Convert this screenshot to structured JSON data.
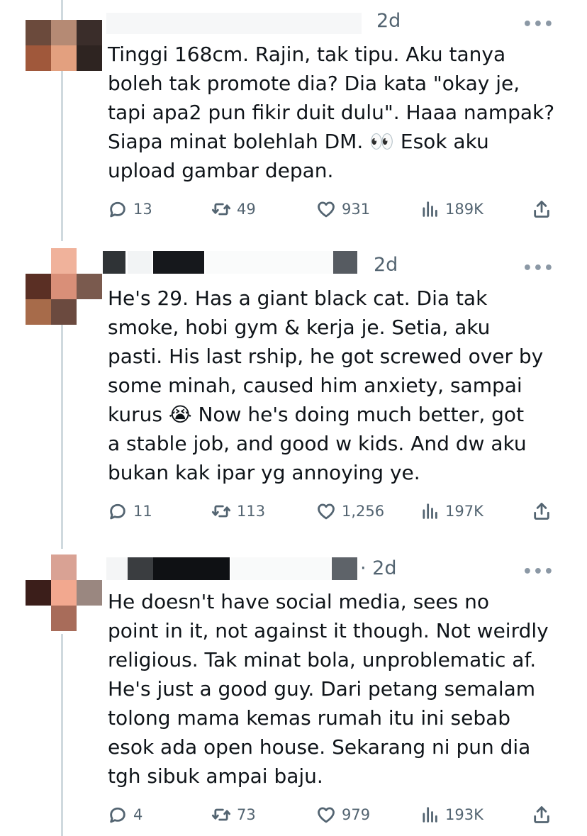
{
  "tweets": [
    {
      "time": "2d",
      "more": "•••",
      "text": "Tinggi 168cm. Rajin, tak tipu. Aku tanya\nboleh tak promote dia? Dia kata \"okay je,\ntapi apa2 pun fikir duit dulu\". Haaa nampak?\nSiapa minat bolehlah DM. 👀 Esok aku\nupload gambar depan.",
      "replies": "13",
      "retweets": "49",
      "likes": "931",
      "views": "189K"
    },
    {
      "time": "2d",
      "more": "•••",
      "text": "He's 29. Has a giant black cat. Dia tak\nsmoke, hobi gym & kerja je. Setia, aku\npasti. His last rship, he got screwed over by\nsome minah, caused him anxiety, sampai\nkurus 😭 Now he's doing much better, got\na stable job, and good w kids. And dw aku\nbukan kak ipar yg annoying ye.",
      "replies": "11",
      "retweets": "113",
      "likes": "1,256",
      "views": "197K"
    },
    {
      "time": "· 2d",
      "more": "•••",
      "text": "He doesn't have social media, sees no\npoint in it, not against it though. Not weirdly\nreligious. Tak minat bola, unproblematic af.\nHe's just a good guy. Dari petang semalam\ntolong mama kemas rumah itu ini sebab\nesok ada open house. Sekarang ni pun dia\ntgh sibuk ampai baju.",
      "replies": "4",
      "retweets": "73",
      "likes": "979",
      "views": "193K"
    }
  ],
  "icons": {
    "reply": "reply-icon",
    "retweet": "retweet-icon",
    "like": "like-icon",
    "views": "views-icon",
    "share": "share-icon"
  }
}
